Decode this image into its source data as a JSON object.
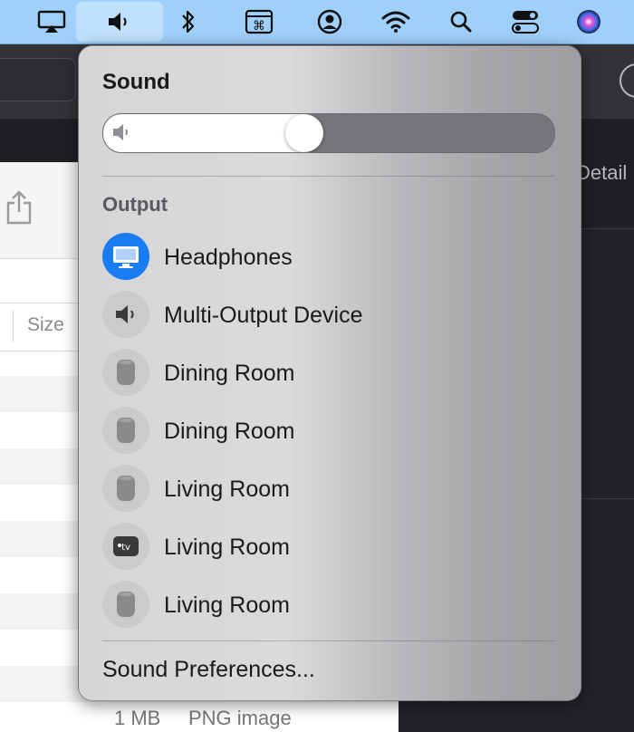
{
  "menubar": {
    "icons": [
      "airplay-icon",
      "volume-icon",
      "bluetooth-icon",
      "keyboard-shortcut-icon",
      "user-account-icon",
      "wifi-icon",
      "search-icon",
      "control-center-icon",
      "siri-icon"
    ]
  },
  "background": {
    "detail_label": "Detail",
    "size_header": "Size",
    "bottom_size": "1 MB",
    "bottom_kind": "PNG image"
  },
  "sound_popup": {
    "title": "Sound",
    "volume_level": 0.44,
    "output_section_label": "Output",
    "outputs": [
      {
        "label": "Headphones",
        "icon": "display-icon",
        "selected": true
      },
      {
        "label": "Multi-Output Device",
        "icon": "speaker-icon",
        "selected": false
      },
      {
        "label": "Dining Room",
        "icon": "homepod-icon",
        "selected": false
      },
      {
        "label": "Dining Room",
        "icon": "homepod-icon",
        "selected": false
      },
      {
        "label": "Living Room",
        "icon": "homepod-icon",
        "selected": false
      },
      {
        "label": "Living Room",
        "icon": "apple-tv-icon",
        "selected": false
      },
      {
        "label": "Living Room",
        "icon": "homepod-icon",
        "selected": false
      }
    ],
    "preferences_label": "Sound Preferences...",
    "selected_color": "#1a7cf2"
  }
}
